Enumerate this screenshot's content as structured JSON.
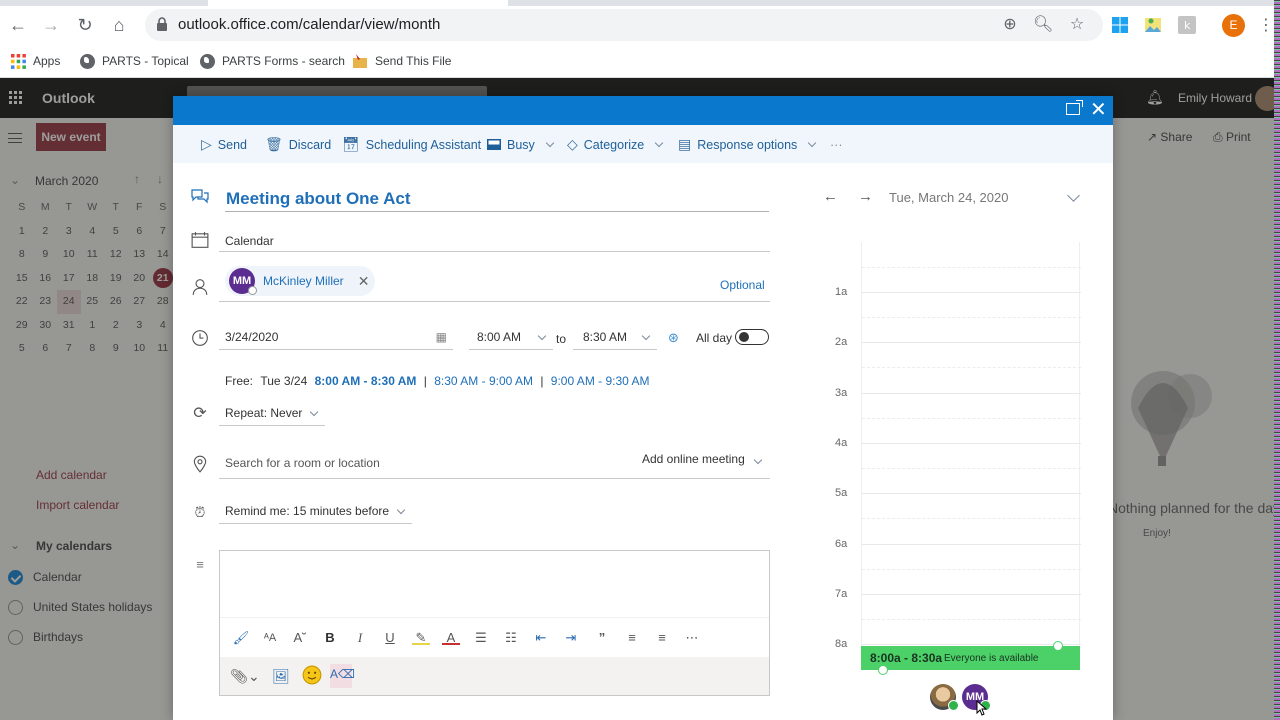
{
  "browser": {
    "url": "outlook.office.com/calendar/view/month",
    "bookmarks": [
      {
        "label": "Apps",
        "icon": "apps-grid-icon"
      },
      {
        "label": "PARTS - Topical",
        "icon": "globe-icon"
      },
      {
        "label": "PARTS Forms - search",
        "icon": "globe-icon"
      },
      {
        "label": "Send This File",
        "icon": "folder-icon"
      }
    ],
    "profile_initial": "E",
    "colors": {
      "profile": "#e8710a"
    }
  },
  "app": {
    "name": "Outlook",
    "user_name": "Emily Howard",
    "new_event_label": "New event",
    "share_label": "Share",
    "print_label": "Print",
    "colors": {
      "header": "#000000",
      "new_event": "#8b2331"
    }
  },
  "sidebar": {
    "month_label": "March 2020",
    "weekdays": [
      "S",
      "M",
      "T",
      "W",
      "T",
      "F",
      "S"
    ],
    "weeks": [
      [
        "1",
        "2",
        "3",
        "4",
        "5",
        "6",
        "7"
      ],
      [
        "8",
        "9",
        "10",
        "11",
        "12",
        "13",
        "14"
      ],
      [
        "15",
        "16",
        "17",
        "18",
        "19",
        "20",
        "21"
      ],
      [
        "22",
        "23",
        "24",
        "25",
        "26",
        "27",
        "28"
      ],
      [
        "29",
        "30",
        "31",
        "1",
        "2",
        "3",
        "4"
      ],
      [
        "5",
        "6",
        "7",
        "8",
        "9",
        "10",
        "11"
      ]
    ],
    "today": "21",
    "selected": "24",
    "add_calendar": "Add calendar",
    "import_calendar": "Import calendar",
    "my_calendars_label": "My calendars",
    "calendars": [
      {
        "label": "Calendar",
        "checked": true
      },
      {
        "label": "United States holidays",
        "checked": false
      },
      {
        "label": "Birthdays",
        "checked": false
      }
    ]
  },
  "agenda": {
    "empty_title": "Nothing planned for the day",
    "empty_sub": "Enjoy!"
  },
  "dialog": {
    "toolbar": {
      "send": "Send",
      "discard": "Discard",
      "scheduling_assistant": "Scheduling Assistant",
      "busy": "Busy",
      "categorize": "Categorize",
      "response_options": "Response options",
      "more": "···"
    },
    "title": "Meeting about One Act",
    "calendar": "Calendar",
    "attendee": {
      "initials": "MM",
      "name": "McKinley Miller"
    },
    "optional_label": "Optional",
    "date": "3/24/2020",
    "start_time": "8:00 AM",
    "to_label": "to",
    "end_time": "8:30 AM",
    "all_day_label": "All day",
    "all_day": false,
    "free": {
      "prefix": "Free:",
      "day": "Tue 3/24",
      "slots": [
        "8:00 AM - 8:30 AM",
        "8:30 AM - 9:00 AM",
        "9:00 AM - 9:30 AM"
      ]
    },
    "repeat": "Repeat:  Never",
    "location_placeholder": "Search for a room or location",
    "online_meeting": "Add online meeting",
    "reminder": "Remind me:  15 minutes before",
    "body": "",
    "colors": {
      "title_bar": "#0a78cc",
      "accent": "#1f6fb8",
      "avatar": "#5c2d91"
    }
  },
  "scheduler": {
    "date_label": "Tue, March 24, 2020",
    "hours": [
      "1a",
      "2a",
      "3a",
      "4a",
      "5a",
      "6a",
      "7a",
      "8a"
    ],
    "event": {
      "time": "8:00a - 8:30a",
      "status": "Everyone is available"
    },
    "attendees": [
      {
        "type": "photo",
        "available": true
      },
      {
        "type": "initials",
        "initials": "MM",
        "available": true
      }
    ],
    "colors": {
      "event": "#4cd068"
    }
  }
}
